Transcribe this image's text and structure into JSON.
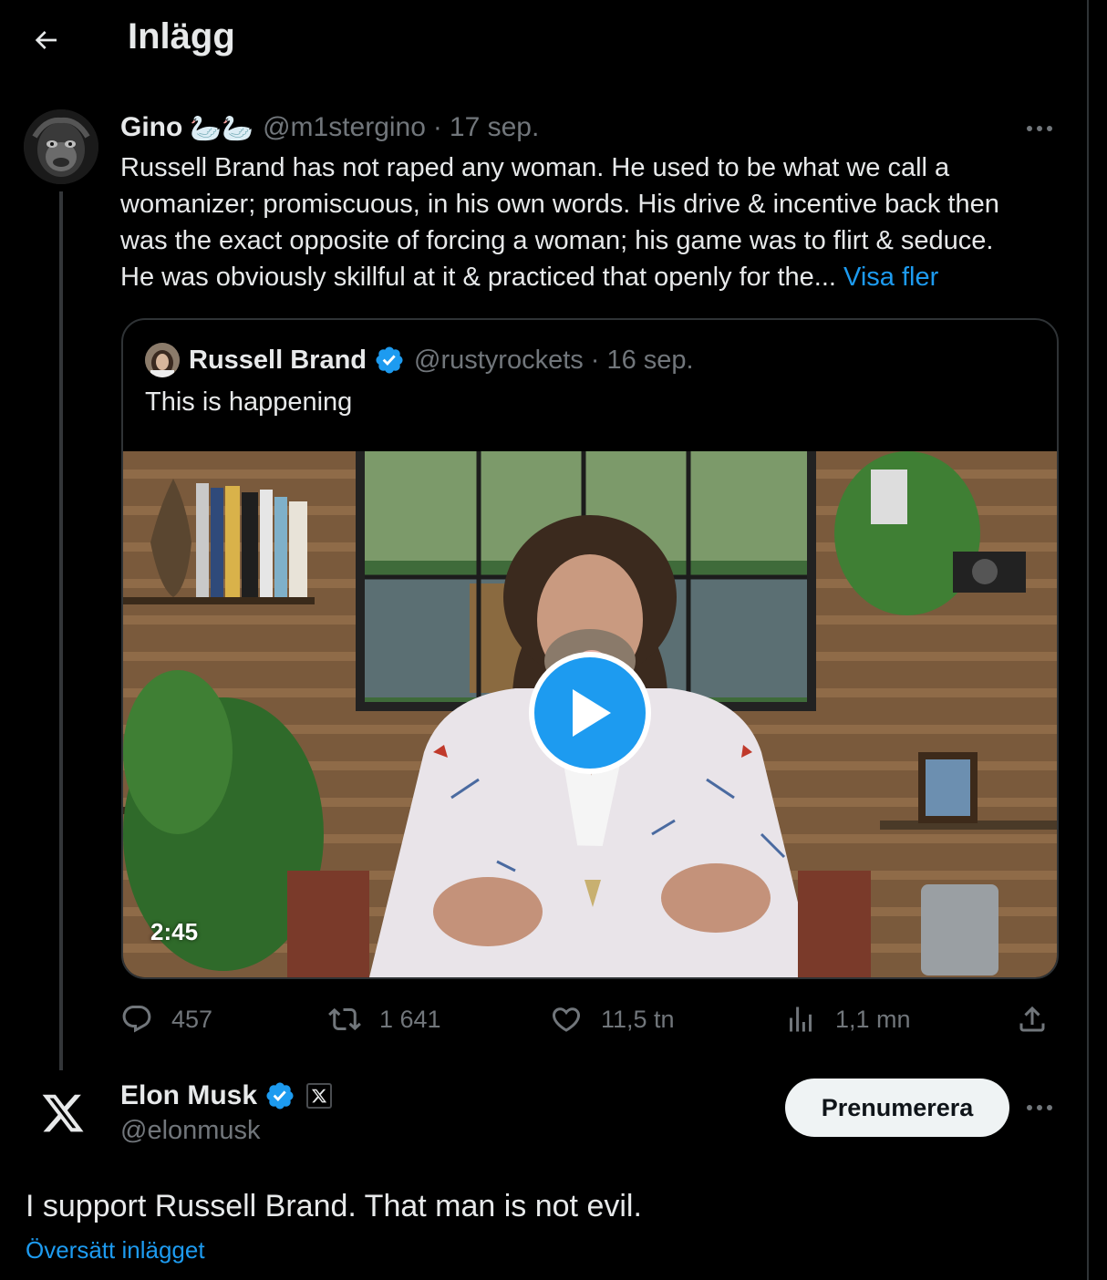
{
  "header": {
    "title": "Inlägg"
  },
  "parent_tweet": {
    "name": "Gino",
    "name_emoji": "🦢🦢",
    "handle": "@m1stergino",
    "separator": "·",
    "date": "17 sep.",
    "text_lines": [
      "Russell Brand has not raped any woman. He used to be what we call a",
      "womanizer; promiscuous, in his own words. His drive & incentive back then",
      "was the exact opposite of forcing a woman; his game was to flirt & seduce.",
      "He was obviously skillful at it & practiced that openly for the..."
    ],
    "show_more": "Visa fler",
    "quote": {
      "name": "Russell Brand",
      "handle": "@rustyrockets",
      "separator": "·",
      "date": "16 sep.",
      "text": "This is happening",
      "video_duration": "2:45"
    },
    "stats": {
      "replies": "457",
      "retweets": "1 641",
      "likes": "11,5 tn",
      "views": "1,1 mn"
    }
  },
  "main_tweet": {
    "name": "Elon Musk",
    "handle": "@elonmusk",
    "affiliate_badge": "𝕏",
    "subscribe_label": "Prenumerera",
    "text": "I support Russell Brand. That man is not evil.",
    "translate_label": "Översätt inlägget"
  },
  "colors": {
    "accent": "#1d9bf0",
    "background": "#000000",
    "text": "#e7e9ea",
    "muted": "#71767b"
  },
  "icons": {
    "back": "arrow-left-icon",
    "more": "more-dots-icon",
    "reply": "reply-bubble-icon",
    "retweet": "retweet-icon",
    "like": "heart-icon",
    "views": "views-bars-icon",
    "share": "share-icon",
    "verified": "verified-badge-icon",
    "x_logo": "x-logo-icon",
    "play": "play-icon"
  }
}
